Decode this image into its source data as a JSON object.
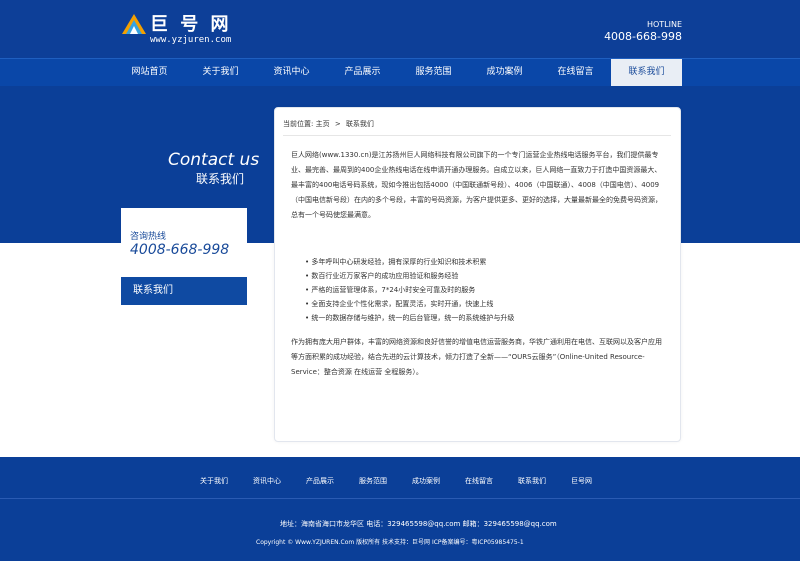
{
  "header": {
    "logo_text": "巨 号 网",
    "logo_url": "www.yzjuren.com",
    "hotline_label": "HOTLINE",
    "hotline_number": "4008-668-998"
  },
  "nav": {
    "items": [
      "网站首页",
      "关于我们",
      "资讯中心",
      "产品展示",
      "服务范围",
      "成功案例",
      "在线留言",
      "联系我们"
    ],
    "active_index": 7
  },
  "banner": {
    "title_en": "Contact us",
    "title_cn": "联系我们"
  },
  "sidebar": {
    "hotline_label": "咨询热线",
    "hotline_number": "4008-668-998",
    "menu_item": "联系我们"
  },
  "content": {
    "breadcrumb_label": "当前位置:",
    "breadcrumb_home": "主页",
    "breadcrumb_sep": ">",
    "breadcrumb_current": "联系我们",
    "paragraph1": "巨人网络(www.1330.cn)是江苏扬州巨人网络科技有限公司旗下的一个专门运营企业热线电话服务平台，我们提供最专业、最完善、最周到的400企业热线电话在线申请开通办理服务。自成立以来，巨人网络一直致力于打造中国资源最大、最丰富的400电话号码系统，现如今推出包括4000（中国联通新号段）、4006（中国联通）、4008（中国电信）、4009（中国电信新号段）在内的多个号段，丰富的号码资源，为客户提供更多、更好的选择，大量最新最全的免费号码资源，总有一个号码使您最满意。",
    "bullets": [
      "多年呼叫中心研发经验，拥有深厚的行业知识和技术积累",
      "数百行业近万家客户的成功应用验证和服务经验",
      "严格的运营管理体系，7*24小时安全可靠及时的服务",
      "全面支持企业个性化需求，配置灵活，实时开通，快速上线",
      "统一的数据存储与维护，统一的后台管理，统一的系统维护与升级"
    ],
    "paragraph2": "作为拥有庞大用户群体，丰富的网络资源和良好信誉的增值电信运营服务商，华铁广通利用在电信、互联网以及客户应用等方面积累的成功经验，结合先进的云计算技术，倾力打造了全新——“OURS云服务”（Online-United Resource- Service：整合资源 在线运营 全程服务）。"
  },
  "footer": {
    "links": [
      "关于我们",
      "资讯中心",
      "产品展示",
      "服务范围",
      "成功案例",
      "在线留言",
      "联系我们",
      "巨号网"
    ],
    "address": "地址：海南省海口市龙华区   电话：329465598@qq.com   邮箱：329465598@qq.com",
    "copyright": "Copyright © Www.YZJUREN.Com 版权所有   技术支持：巨号网   ICP备案编号：粤ICP05985475-1"
  },
  "colors": {
    "primary_blue": "#0b3f98",
    "nav_blue": "#0a47a8",
    "active_nav_bg": "#e9eef5",
    "text_dark": "#333333"
  }
}
